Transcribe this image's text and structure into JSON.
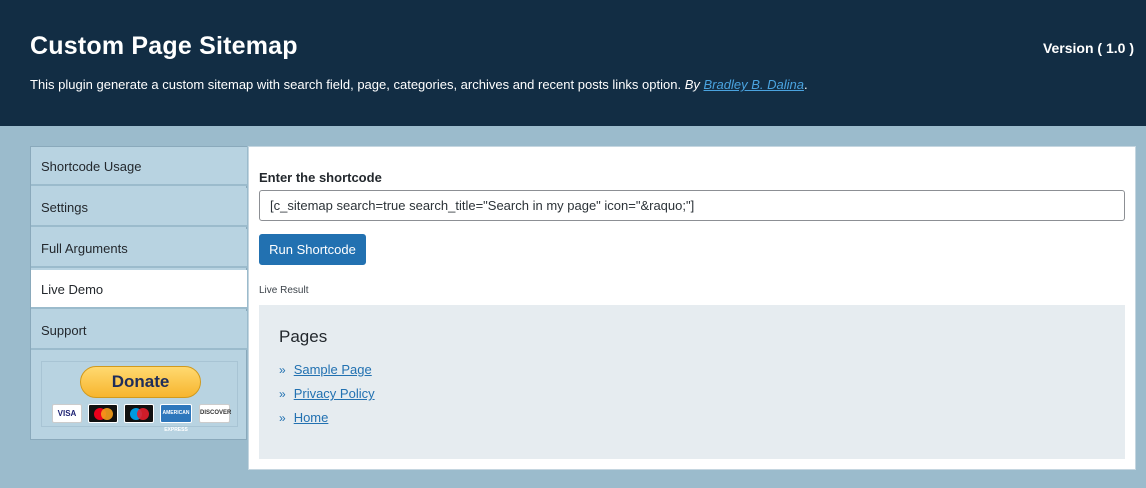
{
  "header": {
    "title": "Custom Page Sitemap",
    "version": "Version ( 1.0 )",
    "description": "This plugin generate a custom sitemap with search field, page, categories, archives and recent posts links option.",
    "by_label": "By",
    "author": "Bradley B. Dalina",
    "period": "."
  },
  "sidebar": {
    "items": [
      {
        "label": "Shortcode Usage"
      },
      {
        "label": "Settings"
      },
      {
        "label": "Full Arguments"
      },
      {
        "label": "Live Demo"
      },
      {
        "label": "Support"
      }
    ],
    "active_item": "Live Demo",
    "donate_label": "Donate",
    "cards": [
      "VISA",
      "MasterCard",
      "Maestro",
      "AMERICAN EXPRESS",
      "DISCOVER"
    ]
  },
  "main": {
    "enter_label": "Enter the shortcode",
    "shortcode_value": "[c_sitemap search=true search_title=\"Search in my page\" icon=\"&raquo;\"]",
    "run_button": "Run Shortcode",
    "live_result_label": "Live Result",
    "result": {
      "heading": "Pages",
      "bullet": "»",
      "links": [
        "Sample Page",
        "Privacy Policy",
        "Home"
      ]
    }
  },
  "colors": {
    "header_bg": "#122d44",
    "page_bg": "#9bbbcc",
    "sidebar_bg": "#b8d3e1",
    "primary_button": "#2271b1",
    "link": "#2271b1",
    "result_bg": "#e6ecf0"
  }
}
